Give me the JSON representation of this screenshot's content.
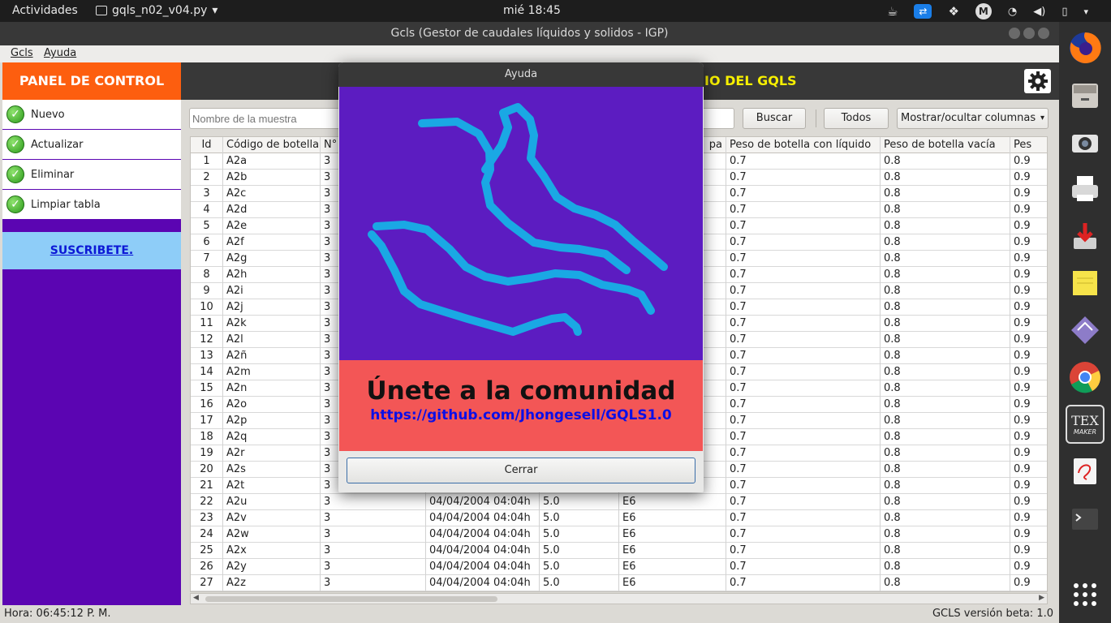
{
  "topbar": {
    "activities": "Actividades",
    "app_name": "gqls_n02_v04.py",
    "app_menu_arrow": "▾",
    "clock": "mié 18:45",
    "tray_icons": [
      "coffee-icon",
      "teamviewer-icon",
      "dropbox-icon",
      "mail-icon",
      "wifi-icon",
      "volume-icon",
      "battery-icon",
      "power-menu-icon"
    ]
  },
  "window": {
    "title": "Gcls (Gestor de caudales líquidos y solidos - IGP)"
  },
  "menubar": {
    "gcls": "Gcls",
    "ayuda": "Ayuda"
  },
  "sidebar": {
    "panel_title": "PANEL DE CONTROL",
    "buttons": [
      {
        "label": "Nuevo"
      },
      {
        "label": "Actualizar"
      },
      {
        "label": "Eliminar"
      },
      {
        "label": "Limpiar tabla"
      }
    ],
    "subscribe": "SUSCRIBETE."
  },
  "header": {
    "title_visible": "IO DEL GQLS"
  },
  "toolbar": {
    "search_placeholder": "Nombre de la muestra",
    "buscar": "Buscar",
    "todos": "Todos",
    "columns": "Mostrar/ocultar columnas",
    "columns_arrow": "▾"
  },
  "table": {
    "headers": [
      "Id",
      "Código de botella",
      "N°",
      "",
      "",
      "pa",
      "Peso de botella con líquido",
      "Peso de botella vacía",
      "Pes"
    ],
    "rows": [
      [
        "1",
        "A2a",
        "3",
        "",
        "",
        "",
        "0.7",
        "0.8",
        "0.9"
      ],
      [
        "2",
        "A2b",
        "3",
        "",
        "",
        "",
        "0.7",
        "0.8",
        "0.9"
      ],
      [
        "3",
        "A2c",
        "3",
        "",
        "",
        "",
        "0.7",
        "0.8",
        "0.9"
      ],
      [
        "4",
        "A2d",
        "3",
        "",
        "",
        "",
        "0.7",
        "0.8",
        "0.9"
      ],
      [
        "5",
        "A2e",
        "3",
        "",
        "",
        "",
        "0.7",
        "0.8",
        "0.9"
      ],
      [
        "6",
        "A2f",
        "3",
        "",
        "",
        "",
        "0.7",
        "0.8",
        "0.9"
      ],
      [
        "7",
        "A2g",
        "3",
        "",
        "",
        "",
        "0.7",
        "0.8",
        "0.9"
      ],
      [
        "8",
        "A2h",
        "3",
        "",
        "",
        "",
        "0.7",
        "0.8",
        "0.9"
      ],
      [
        "9",
        "A2i",
        "3",
        "",
        "",
        "",
        "0.7",
        "0.8",
        "0.9"
      ],
      [
        "10",
        "A2j",
        "3",
        "",
        "",
        "",
        "0.7",
        "0.8",
        "0.9"
      ],
      [
        "11",
        "A2k",
        "3",
        "",
        "",
        "",
        "0.7",
        "0.8",
        "0.9"
      ],
      [
        "12",
        "A2l",
        "3",
        "",
        "",
        "",
        "0.7",
        "0.8",
        "0.9"
      ],
      [
        "13",
        "A2ñ",
        "3",
        "",
        "",
        "",
        "0.7",
        "0.8",
        "0.9"
      ],
      [
        "14",
        "A2m",
        "3",
        "",
        "",
        "",
        "0.7",
        "0.8",
        "0.9"
      ],
      [
        "15",
        "A2n",
        "3",
        "",
        "",
        "",
        "0.7",
        "0.8",
        "0.9"
      ],
      [
        "16",
        "A2o",
        "3",
        "",
        "",
        "",
        "0.7",
        "0.8",
        "0.9"
      ],
      [
        "17",
        "A2p",
        "3",
        "",
        "",
        "",
        "0.7",
        "0.8",
        "0.9"
      ],
      [
        "18",
        "A2q",
        "3",
        "",
        "",
        "",
        "0.7",
        "0.8",
        "0.9"
      ],
      [
        "19",
        "A2r",
        "3",
        "",
        "",
        "",
        "0.7",
        "0.8",
        "0.9"
      ],
      [
        "20",
        "A2s",
        "3",
        "",
        "",
        "",
        "0.7",
        "0.8",
        "0.9"
      ],
      [
        "21",
        "A2t",
        "3",
        "",
        "",
        "",
        "0.7",
        "0.8",
        "0.9"
      ],
      [
        "22",
        "A2u",
        "3",
        "04/04/2004 04:04h",
        "5.0",
        "E6",
        "0.7",
        "0.8",
        "0.9"
      ],
      [
        "23",
        "A2v",
        "3",
        "04/04/2004 04:04h",
        "5.0",
        "E6",
        "0.7",
        "0.8",
        "0.9"
      ],
      [
        "24",
        "A2w",
        "3",
        "04/04/2004 04:04h",
        "5.0",
        "E6",
        "0.7",
        "0.8",
        "0.9"
      ],
      [
        "25",
        "A2x",
        "3",
        "04/04/2004 04:04h",
        "5.0",
        "E6",
        "0.7",
        "0.8",
        "0.9"
      ],
      [
        "26",
        "A2y",
        "3",
        "04/04/2004 04:04h",
        "5.0",
        "E6",
        "0.7",
        "0.8",
        "0.9"
      ],
      [
        "27",
        "A2z",
        "3",
        "04/04/2004 04:04h",
        "5.0",
        "E6",
        "0.7",
        "0.8",
        "0.9"
      ]
    ]
  },
  "statusbar": {
    "time": "Hora: 06:45:12 P. M.",
    "version": "GCLS versión beta: 1.0"
  },
  "dialog": {
    "title": "Ayuda",
    "heading": "Únete a la comunidad",
    "url": "https://github.com/Jhongesell/GQLS1.0",
    "close": "Cerrar"
  },
  "dock": {
    "icons": [
      "firefox-icon",
      "file-manager-icon",
      "camera-icon",
      "printer-icon",
      "installer-icon",
      "sticky-notes-icon",
      "ruler-icon",
      "chrome-icon",
      "texmaker-icon",
      "document-viewer-icon",
      "terminal-icon",
      "show-apps-icon"
    ],
    "texmaker_text": "TEX",
    "texmaker_sub": "MAKER"
  },
  "colors": {
    "panel_orange": "#fd5e0f",
    "sidebar_purple": "#5b05b2",
    "header_yellow": "#f7f000",
    "banner_purple": "#5c1cc1",
    "banner_red": "#f35656",
    "link_blue": "#0c0fe6",
    "river_cyan": "#1aa8e4"
  }
}
